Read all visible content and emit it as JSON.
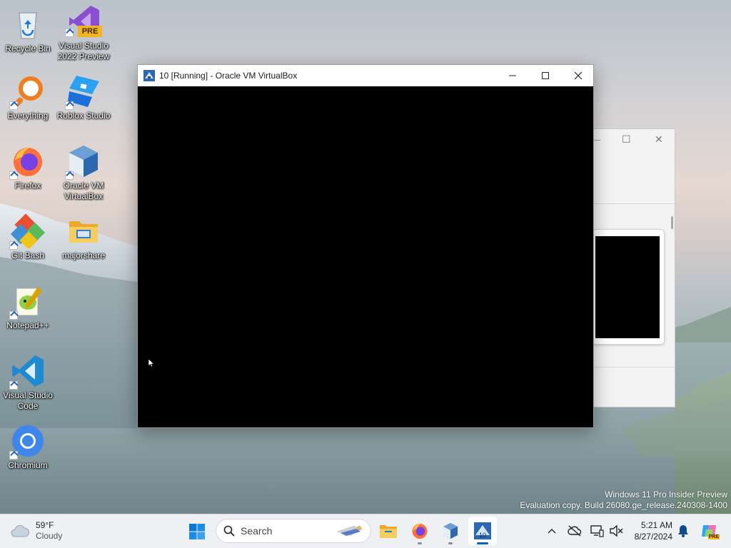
{
  "desktop": {
    "icons": [
      {
        "label": "Recycle Bin",
        "icon": "recycle-bin-icon"
      },
      {
        "label": "Visual Studio\n2022 Preview",
        "icon": "visual-studio-preview-icon",
        "badge": "PRE"
      },
      {
        "label": "Everything",
        "icon": "everything-search-icon"
      },
      {
        "label": "Roblox Studio",
        "icon": "roblox-studio-icon"
      },
      {
        "label": "Firefox",
        "icon": "firefox-icon"
      },
      {
        "label": "Oracle VM\nVirtualBox",
        "icon": "virtualbox-icon"
      },
      {
        "label": "Git Bash",
        "icon": "git-bash-icon"
      },
      {
        "label": "majorshare",
        "icon": "folder-icon"
      },
      {
        "label": "Notepad++",
        "icon": "notepad-plus-plus-icon"
      },
      {
        "label": "Visual Studio\nCode",
        "icon": "vscode-icon"
      },
      {
        "label": "Chromium",
        "icon": "chromium-icon"
      }
    ]
  },
  "vm_window": {
    "title": "10 [Running] - Oracle VM VirtualBox",
    "minimize_glyph": "—",
    "maximize_glyph": "☐",
    "close_glyph": "✕"
  },
  "background_window": {
    "maximize_glyph": "☐",
    "close_glyph": "✕"
  },
  "watermark": {
    "line1": "Windows 11 Pro Insider Preview",
    "line2": "Evaluation copy. Build 26080.ge_release.240308-1400"
  },
  "taskbar": {
    "weather": {
      "temp": "59°F",
      "condition": "Cloudy"
    },
    "search": {
      "placeholder": "Search"
    },
    "clock": {
      "time": "5:21 AM",
      "date": "8/27/2024"
    },
    "copilot_badge": "PRE",
    "colors": {
      "accent": "#0067c0",
      "taskbar_bg": "#eef0f3"
    }
  }
}
